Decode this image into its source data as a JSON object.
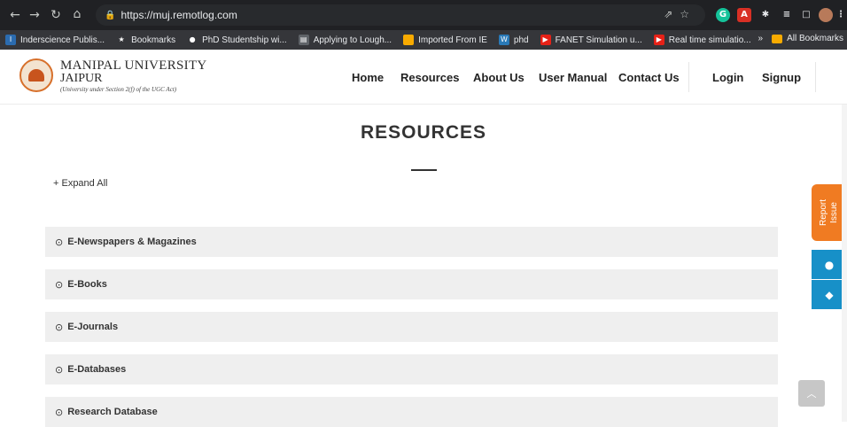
{
  "browser": {
    "url": "https://muj.remotlog.com",
    "bookmarks": [
      {
        "label": "Inderscience Publis...",
        "icon": "inderscience-icon",
        "color": "#2b6cb0"
      },
      {
        "label": "Bookmarks",
        "icon": "star-icon",
        "color": "#35363a"
      },
      {
        "label": "PhD Studentship wi...",
        "icon": "globe-icon",
        "color": "#35363a"
      },
      {
        "label": "Applying to Lough...",
        "icon": "page-icon",
        "color": "#5f6368"
      },
      {
        "label": "Imported From IE",
        "icon": "folder-icon",
        "color": "#f9ab00"
      },
      {
        "label": "phd",
        "icon": "w3-icon",
        "color": "#2a7ab8"
      },
      {
        "label": "FANET Simulation u...",
        "icon": "youtube-icon",
        "color": "#e62117"
      },
      {
        "label": "Real time simulatio...",
        "icon": "youtube-icon",
        "color": "#e62117"
      }
    ],
    "overflow_label": "»",
    "all_bookmarks": "All Bookmarks"
  },
  "header": {
    "university_name": "MANIPAL UNIVERSITY",
    "university_city": "JAIPUR",
    "university_sub": "(University under Section 2(f) of the UGC Act)",
    "nav": [
      "Home",
      "Resources",
      "About Us",
      "User Manual",
      "Contact Us"
    ],
    "login": "Login",
    "signup": "Signup"
  },
  "main": {
    "title": "RESOURCES",
    "expand_all": "+ Expand All",
    "sections": [
      "E-Newspapers & Magazines",
      "E-Books",
      "E-Journals",
      "E-Databases",
      "Research Database"
    ]
  },
  "widgets": {
    "report_issue": [
      "Report",
      "Issue"
    ],
    "apple_icon": "apple-icon",
    "android_icon": "android-icon"
  },
  "colors": {
    "accent_orange": "#f07b22",
    "store_blue": "#1790c8"
  }
}
